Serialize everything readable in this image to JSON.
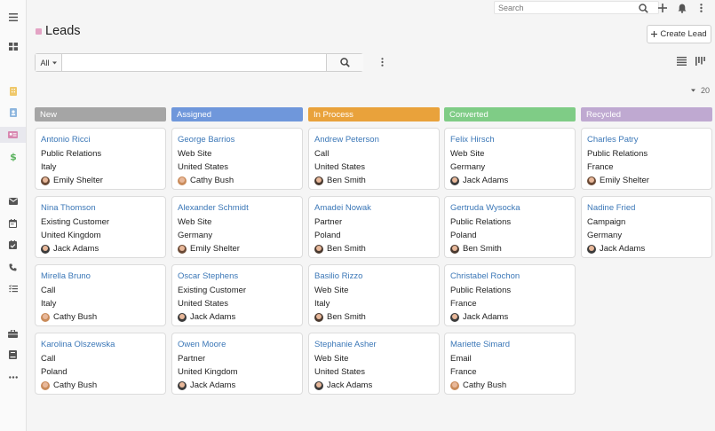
{
  "page": {
    "title": "Leads",
    "create_label": "Create Lead",
    "page_size": "20"
  },
  "topbar": {
    "search_placeholder": "Search"
  },
  "filter": {
    "scope": "All",
    "value": ""
  },
  "sidebar": {
    "items": [
      {
        "icon": "menu-icon"
      },
      {
        "icon": "dashboard-icon"
      },
      {
        "icon": "accounts-icon"
      },
      {
        "icon": "contacts-icon"
      },
      {
        "icon": "leads-icon"
      },
      {
        "icon": "opportunities-icon"
      },
      {
        "icon": "emails-icon"
      },
      {
        "icon": "meetings-icon"
      },
      {
        "icon": "tasks-icon"
      },
      {
        "icon": "calls-icon"
      },
      {
        "icon": "cases-icon"
      },
      {
        "icon": "briefcase-icon"
      },
      {
        "icon": "knowledge-base-icon"
      },
      {
        "icon": "more-icon"
      }
    ]
  },
  "colors": {
    "new": "#a5a5a5",
    "assigned": "#6f97db",
    "in_process": "#e9a23b",
    "converted": "#7fcc86",
    "recycled": "#bfa9d1",
    "link": "#3b77b7"
  },
  "board": {
    "columns": [
      {
        "label": "New",
        "cards": [
          {
            "name": "Antonio Ricci",
            "source": "Public Relations",
            "country": "Italy",
            "user": "Emily Shelter"
          },
          {
            "name": "Nina Thomson",
            "source": "Existing Customer",
            "country": "United Kingdom",
            "user": "Jack Adams"
          },
          {
            "name": "Mirella Bruno",
            "source": "Call",
            "country": "Italy",
            "user": "Cathy Bush"
          },
          {
            "name": "Karolina Olszewska",
            "source": "Call",
            "country": "Poland",
            "user": "Cathy Bush"
          }
        ]
      },
      {
        "label": "Assigned",
        "cards": [
          {
            "name": "George Barrios",
            "source": "Web Site",
            "country": "United States",
            "user": "Cathy Bush"
          },
          {
            "name": "Alexander Schmidt",
            "source": "Web Site",
            "country": "Germany",
            "user": "Emily Shelter"
          },
          {
            "name": "Oscar Stephens",
            "source": "Existing Customer",
            "country": "United States",
            "user": "Jack Adams"
          },
          {
            "name": "Owen Moore",
            "source": "Partner",
            "country": "United Kingdom",
            "user": "Jack Adams"
          }
        ]
      },
      {
        "label": "In Process",
        "cards": [
          {
            "name": "Andrew Peterson",
            "source": "Call",
            "country": "United States",
            "user": "Ben Smith"
          },
          {
            "name": "Amadei Nowak",
            "source": "Partner",
            "country": "Poland",
            "user": "Ben Smith"
          },
          {
            "name": "Basilio Rizzo",
            "source": "Web Site",
            "country": "Italy",
            "user": "Ben Smith"
          },
          {
            "name": "Stephanie Asher",
            "source": "Web Site",
            "country": "United States",
            "user": "Jack Adams"
          }
        ]
      },
      {
        "label": "Converted",
        "cards": [
          {
            "name": "Felix Hirsch",
            "source": "Web Site",
            "country": "Germany",
            "user": "Jack Adams"
          },
          {
            "name": "Gertruda Wysocka",
            "source": "Public Relations",
            "country": "Poland",
            "user": "Ben Smith"
          },
          {
            "name": "Christabel Rochon",
            "source": "Public Relations",
            "country": "France",
            "user": "Jack Adams"
          },
          {
            "name": "Mariette Simard",
            "source": "Email",
            "country": "France",
            "user": "Cathy Bush"
          }
        ]
      },
      {
        "label": "Recycled",
        "cards": [
          {
            "name": "Charles Patry",
            "source": "Public Relations",
            "country": "France",
            "user": "Emily Shelter"
          },
          {
            "name": "Nadine Fried",
            "source": "Campaign",
            "country": "Germany",
            "user": "Jack Adams"
          }
        ]
      }
    ]
  }
}
